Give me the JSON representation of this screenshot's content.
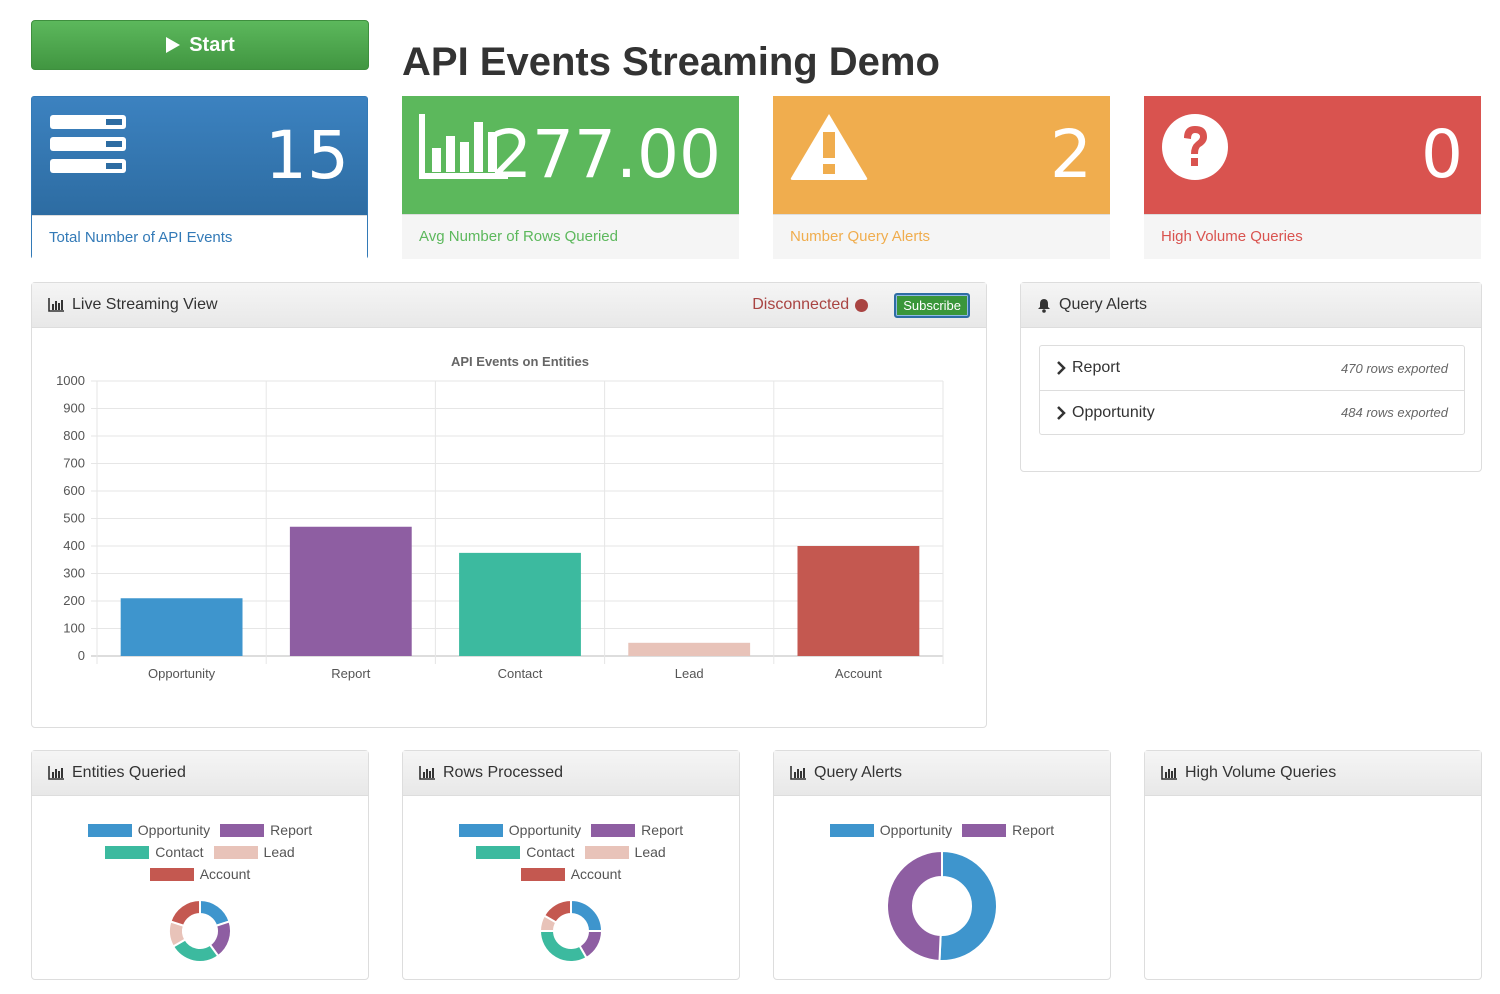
{
  "header": {
    "start_label": "Start",
    "title": "API Events Streaming Demo"
  },
  "stats": [
    {
      "value": "15",
      "label": "Total Number of API Events",
      "icon": "server-icon",
      "color": "#337ab7"
    },
    {
      "value": "277.00",
      "label": "Avg Number of Rows Queried",
      "icon": "bar-chart-icon",
      "color": "#5cb85c"
    },
    {
      "value": "2",
      "label": "Number Query Alerts",
      "icon": "warning-icon",
      "color": "#f0ad4e"
    },
    {
      "value": "0",
      "label": "High Volume Queries",
      "icon": "question-circle-icon",
      "color": "#d9534f"
    }
  ],
  "live": {
    "title": "Live Streaming View",
    "status": "Disconnected",
    "subscribe_label": "Subscribe"
  },
  "alerts": {
    "title": "Query Alerts",
    "items": [
      {
        "entity": "Report",
        "rows": "470 rows exported"
      },
      {
        "entity": "Opportunity",
        "rows": "484 rows exported"
      }
    ]
  },
  "chart_data": [
    {
      "type": "bar",
      "title": "API Events on Entities",
      "categories": [
        "Opportunity",
        "Report",
        "Contact",
        "Lead",
        "Account"
      ],
      "values": [
        210,
        470,
        375,
        48,
        400
      ],
      "colors": [
        "#3e95cd",
        "#8e5ea2",
        "#3cba9f",
        "#e8c3b9",
        "#c45850"
      ],
      "ylim": [
        0,
        1000
      ],
      "yticks": [
        "0",
        "100",
        "200",
        "300",
        "400",
        "500",
        "600",
        "700",
        "800",
        "900",
        "1000"
      ],
      "grid": true
    },
    {
      "type": "pie",
      "title": "Entities Queried",
      "categories": [
        "Opportunity",
        "Report",
        "Contact",
        "Lead",
        "Account"
      ],
      "values": [
        3,
        3,
        4,
        2,
        3
      ],
      "colors": [
        "#3e95cd",
        "#8e5ea2",
        "#3cba9f",
        "#e8c3b9",
        "#c45850"
      ]
    },
    {
      "type": "pie",
      "title": "Rows Processed",
      "categories": [
        "Opportunity",
        "Report",
        "Contact",
        "Lead",
        "Account"
      ],
      "values": [
        3,
        2,
        4,
        1,
        2
      ],
      "colors": [
        "#3e95cd",
        "#8e5ea2",
        "#3cba9f",
        "#e8c3b9",
        "#c45850"
      ]
    },
    {
      "type": "pie",
      "title": "Query Alerts",
      "categories": [
        "Opportunity",
        "Report"
      ],
      "values": [
        484,
        470
      ],
      "colors": [
        "#3e95cd",
        "#8e5ea2"
      ]
    },
    {
      "type": "pie",
      "title": "High Volume Queries",
      "categories": [],
      "values": [],
      "colors": []
    }
  ]
}
